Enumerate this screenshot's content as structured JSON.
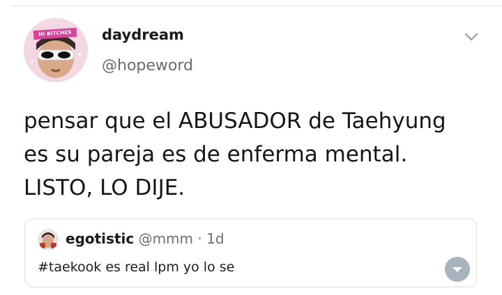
{
  "tweet": {
    "display_name": "daydream",
    "handle": "@hopeword",
    "avatar_caption": "HI BITCHES",
    "text": "pensar que el ABUSADOR de Taehyung\nes su pareja es de enferma mental.\nLISTO, LO DIJE.",
    "menu_icon": "chevron-down-icon"
  },
  "quoted": {
    "display_name": "egotistic",
    "handle": "@mmm",
    "separator": "·",
    "time": "1d",
    "text": "#taekook es real lpm yo lo se",
    "expand_icon": "chevron-down-icon"
  },
  "colors": {
    "text": "#1c1c1c",
    "muted": "#6b6b6b",
    "border": "#dadde0",
    "expand_button": "#a7b4bd"
  }
}
